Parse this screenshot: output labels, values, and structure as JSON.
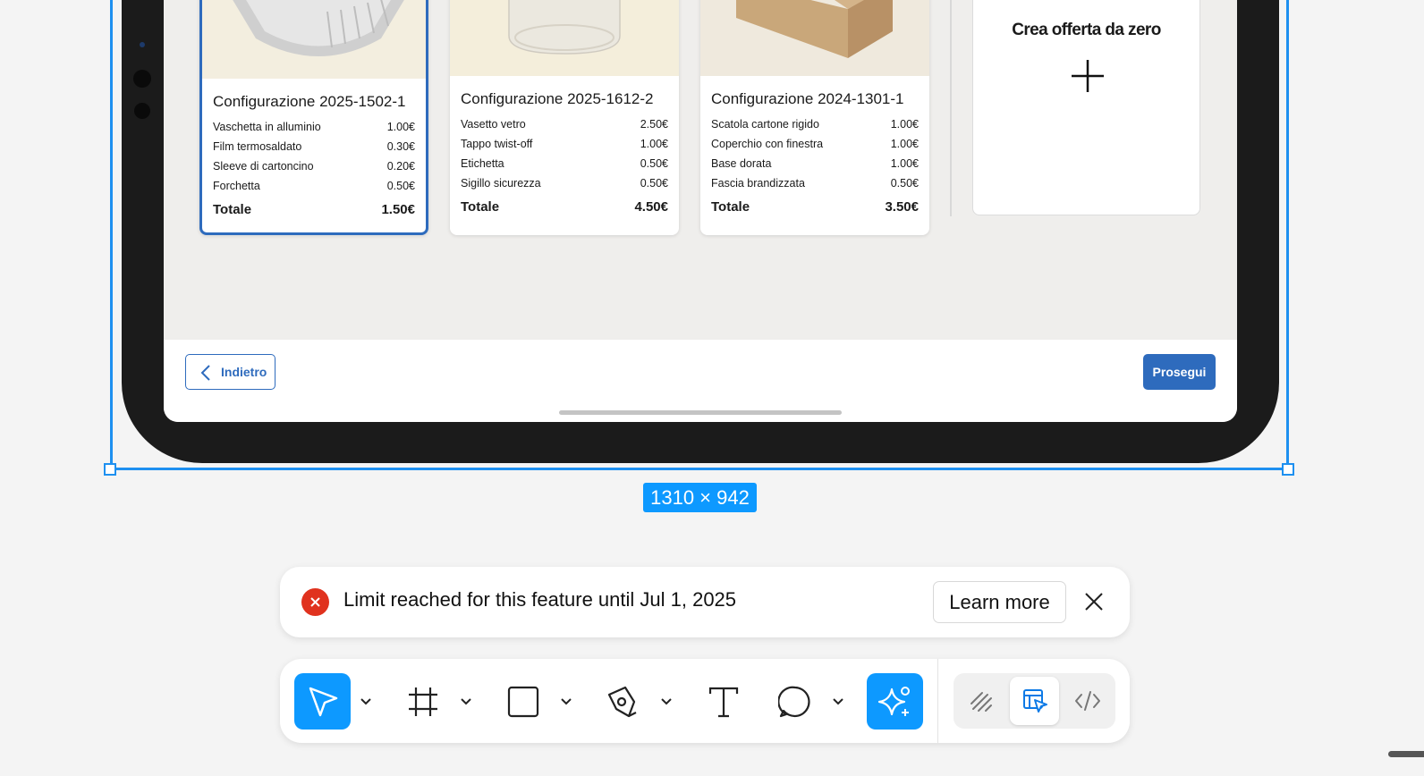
{
  "cards": [
    {
      "title": "Configurazione 2025-1502-1",
      "selected": true,
      "image": "aluminum-tray",
      "items": [
        {
          "name": "Vaschetta in alluminio",
          "price": "1.00€"
        },
        {
          "name": "Film termosaldato",
          "price": "0.30€"
        },
        {
          "name": "Sleeve di cartoncino",
          "price": "0.20€"
        },
        {
          "name": "Forchetta",
          "price": "0.50€"
        }
      ],
      "total_label": "Totale",
      "total": "1.50€"
    },
    {
      "title": "Configurazione 2025-1612-2",
      "selected": false,
      "image": "glass-jar",
      "items": [
        {
          "name": "Vasetto vetro",
          "price": "2.50€"
        },
        {
          "name": "Tappo twist-off",
          "price": "1.00€"
        },
        {
          "name": "Etichetta",
          "price": "0.50€"
        },
        {
          "name": "Sigillo sicurezza",
          "price": "0.50€"
        }
      ],
      "total_label": "Totale",
      "total": "4.50€"
    },
    {
      "title": "Configurazione 2024-1301-1",
      "selected": false,
      "image": "cardboard-box",
      "items": [
        {
          "name": "Scatola cartone rigido",
          "price": "1.00€"
        },
        {
          "name": "Coperchio con finestra",
          "price": "1.00€"
        },
        {
          "name": "Base dorata",
          "price": "1.00€"
        },
        {
          "name": "Fascia brandizzata",
          "price": "0.50€"
        }
      ],
      "total_label": "Totale",
      "total": "3.50€"
    }
  ],
  "create_card": {
    "title": "Crea offerta da zero",
    "icon": "plus-icon"
  },
  "footer": {
    "back_label": "Indietro",
    "next_label": "Prosegui"
  },
  "frame": {
    "dimensions_label": "1310 × 942"
  },
  "toast": {
    "message": "Limit reached for this feature until Jul 1, 2025",
    "learn_more_label": "Learn more",
    "icon": "error-icon"
  },
  "toolbar": {
    "tools": [
      "move-tool",
      "frame-tool",
      "rectangle-tool",
      "pen-tool",
      "text-tool",
      "comment-tool",
      "ai-actions-tool"
    ],
    "active_tool": "move-tool",
    "modes": [
      "draw-mode",
      "design-mode",
      "dev-mode"
    ],
    "active_mode": "design-mode"
  },
  "colors": {
    "accent": "#0d99ff",
    "primary_button": "#2e6bbd",
    "error": "#e0321e"
  }
}
